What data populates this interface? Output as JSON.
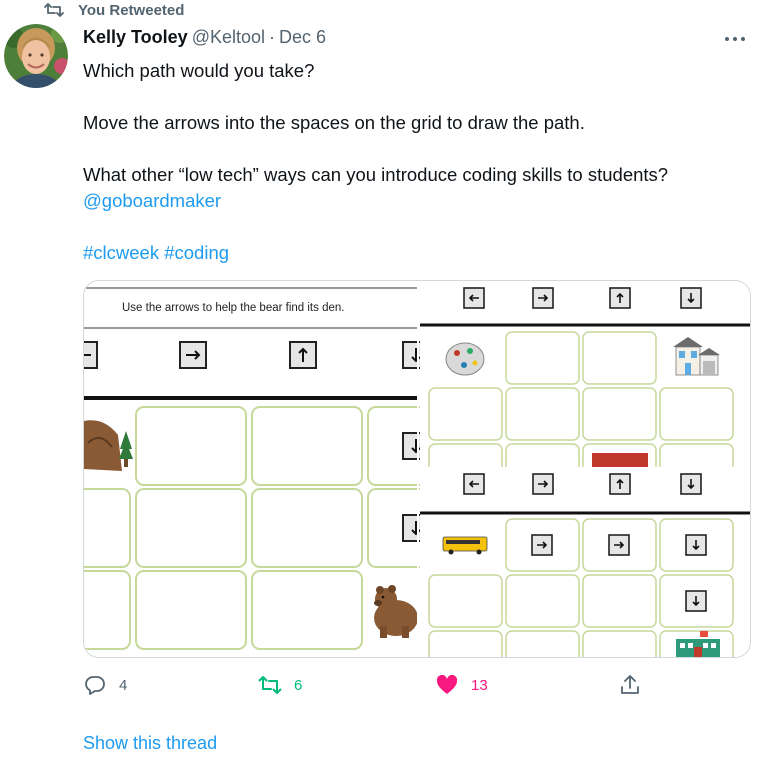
{
  "retweet_header": {
    "label": "You Retweeted",
    "icon": "retweet-icon"
  },
  "author": {
    "name": "Kelly Tooley",
    "handle": "@Keltool",
    "separator": "·",
    "date": "Dec 6"
  },
  "tweet": {
    "line1": "Which path would you take?",
    "line2": "Move the arrows into the spaces on the grid to draw the path.",
    "line3": "What other “low tech” ways can you introduce coding skills to students?",
    "mention": "@goboardmaker",
    "hashtag1": "#clcweek",
    "hashtag2": "#coding"
  },
  "media": {
    "instruction": "Use the arrows to help the bear find its den."
  },
  "actions": {
    "replies": "4",
    "retweets": "6",
    "likes": "13",
    "reply_icon": "reply-icon",
    "retweet_icon": "retweet-icon",
    "like_icon": "heart-icon",
    "share_icon": "share-icon"
  },
  "show_thread": "Show this thread",
  "colors": {
    "link": "#1d9bf0",
    "retweet": "#00ba7c",
    "like": "#f91880",
    "muted": "#536471",
    "grid_border": "#c6d89a"
  }
}
